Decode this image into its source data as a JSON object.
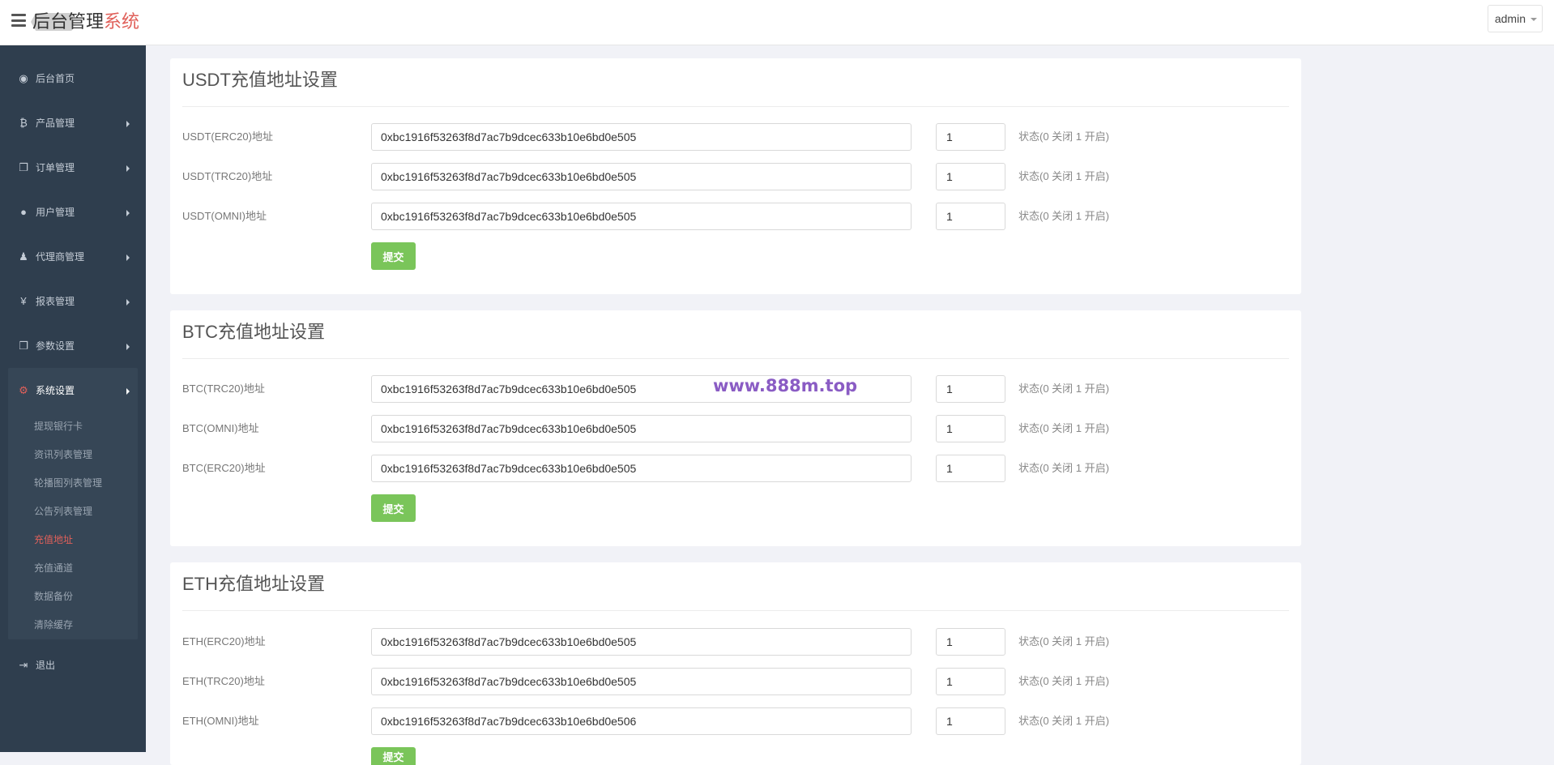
{
  "header": {
    "brand_main": "后台管理",
    "brand_accent": "系统",
    "user": "admin"
  },
  "sidebar": {
    "items": [
      {
        "label": "后台首页",
        "icon": "dashboard-icon"
      },
      {
        "label": "产品管理",
        "icon": "bitcoin-icon"
      },
      {
        "label": "订单管理",
        "icon": "copy-icon"
      },
      {
        "label": "用户管理",
        "icon": "user-icon"
      },
      {
        "label": "代理商管理",
        "icon": "sitemap-icon"
      },
      {
        "label": "报表管理",
        "icon": "yen-icon"
      },
      {
        "label": "参数设置",
        "icon": "copy-icon"
      }
    ],
    "active_group": {
      "label": "系统设置",
      "icon": "cogs-icon",
      "sub_items": [
        {
          "label": "提现银行卡",
          "active": false
        },
        {
          "label": "资讯列表管理",
          "active": false
        },
        {
          "label": "轮播图列表管理",
          "active": false
        },
        {
          "label": "公告列表管理",
          "active": false
        },
        {
          "label": "充值地址",
          "active": true
        },
        {
          "label": "充值通道",
          "active": false
        },
        {
          "label": "数据备份",
          "active": false
        },
        {
          "label": "清除缓存",
          "active": false
        }
      ]
    },
    "logout": {
      "label": "退出",
      "icon": "sign-out-icon"
    }
  },
  "colors": {
    "sidebar_bg": "#2f3e4e",
    "accent_red": "#e0605a",
    "submit_green": "#7ac55a",
    "watermark": "#8a5cc4"
  },
  "sections": [
    {
      "title": "USDT充值地址设置",
      "rows": [
        {
          "label": "USDT(ERC20)地址",
          "address": "0xbc1916f53263f8d7ac7b9dcec633b10e6bd0e505",
          "status": "1"
        },
        {
          "label": "USDT(TRC20)地址",
          "address": "0xbc1916f53263f8d7ac7b9dcec633b10e6bd0e505",
          "status": "1"
        },
        {
          "label": "USDT(OMNI)地址",
          "address": "0xbc1916f53263f8d7ac7b9dcec633b10e6bd0e505",
          "status": "1"
        }
      ],
      "submit_label": "提交"
    },
    {
      "title": "BTC充值地址设置",
      "rows": [
        {
          "label": "BTC(TRC20)地址",
          "address": "0xbc1916f53263f8d7ac7b9dcec633b10e6bd0e505",
          "status": "1"
        },
        {
          "label": "BTC(OMNI)地址",
          "address": "0xbc1916f53263f8d7ac7b9dcec633b10e6bd0e505",
          "status": "1"
        },
        {
          "label": "BTC(ERC20)地址",
          "address": "0xbc1916f53263f8d7ac7b9dcec633b10e6bd0e505",
          "status": "1"
        }
      ],
      "submit_label": "提交"
    },
    {
      "title": "ETH充值地址设置",
      "rows": [
        {
          "label": "ETH(ERC20)地址",
          "address": "0xbc1916f53263f8d7ac7b9dcec633b10e6bd0e505",
          "status": "1"
        },
        {
          "label": "ETH(TRC20)地址",
          "address": "0xbc1916f53263f8d7ac7b9dcec633b10e6bd0e505",
          "status": "1"
        },
        {
          "label": "ETH(OMNI)地址",
          "address": "0xbc1916f53263f8d7ac7b9dcec633b10e6bd0e506",
          "status": "1"
        }
      ],
      "submit_label": "提交"
    }
  ],
  "status_hint": "状态(0 关闭 1 开启)",
  "watermark": "www.888m.top"
}
